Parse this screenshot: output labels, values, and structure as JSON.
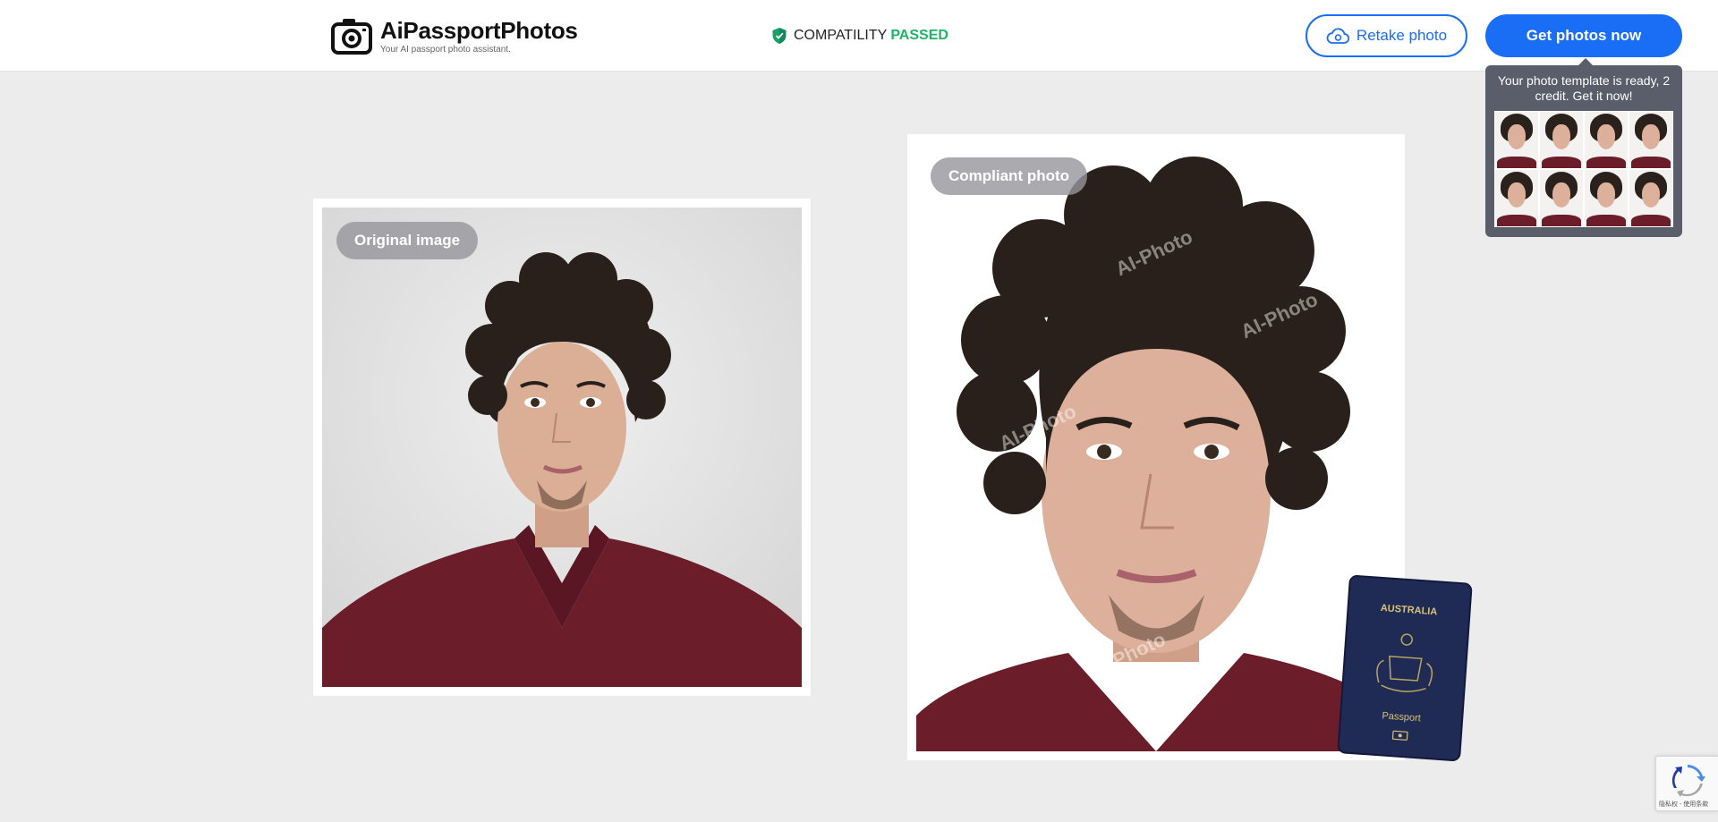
{
  "header": {
    "brand_title": "AiPassportPhotos",
    "brand_subtitle": "Your AI passport photo assistant.",
    "compat_label": "COMPATILITY",
    "compat_status": "PASSED",
    "retake_label": "Retake photo",
    "get_label": "Get photos now"
  },
  "tooltip": {
    "text": "Your photo template is ready, 2 credit. Get it now!"
  },
  "photos": {
    "original_label": "Original image",
    "compliant_label": "Compliant photo",
    "watermark": "AI-Photo"
  },
  "passport": {
    "country": "AUSTRALIA",
    "label": "Passport"
  },
  "recaptcha": {
    "text": "隐私权 - 使用条款"
  },
  "colors": {
    "accent": "#1a6ef5",
    "passed": "#1db566",
    "page_bg": "#ececec",
    "tooltip_bg": "#5a5d6a",
    "shirt": "#6b1d2a"
  }
}
